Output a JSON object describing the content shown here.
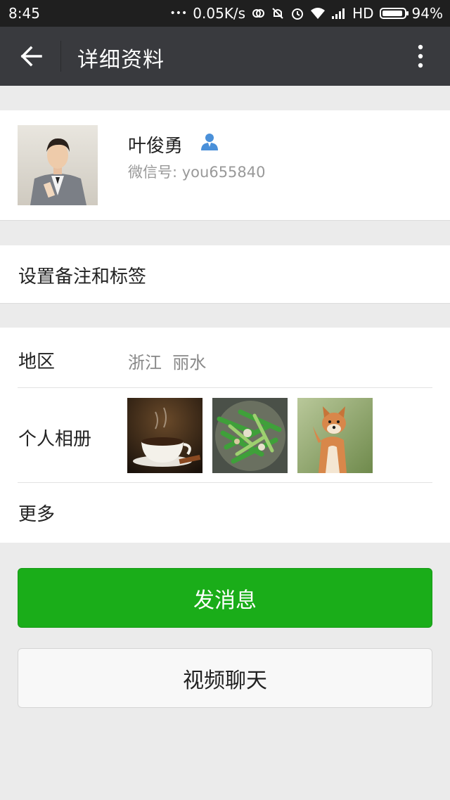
{
  "status_bar": {
    "time": "8:45",
    "dots": "•••",
    "network_speed": "0.05K/s",
    "network_type": "HD",
    "battery_percent": "94%",
    "battery_level": 0.94,
    "icons": [
      "sync-icon",
      "mute-icon",
      "alarm-icon",
      "wifi-icon",
      "signal-icon",
      "battery-icon"
    ]
  },
  "title_bar": {
    "title": "详细资料",
    "back_icon": "arrow-left-icon",
    "more_icon": "more-vertical-icon"
  },
  "profile": {
    "name": "叶俊勇",
    "wechat_id": "微信号: you655840",
    "contact_icon": "contact-person-icon"
  },
  "remark": {
    "label": "设置备注和标签"
  },
  "info": {
    "region_label": "地区",
    "region_value": "浙江  丽水",
    "album_label": "个人相册",
    "album_photos": [
      "coffee-photo",
      "vegetables-photo",
      "shiba-dog-photo"
    ],
    "more_label": "更多"
  },
  "actions": {
    "send_message": "发消息",
    "video_chat": "视频聊天"
  },
  "colors": {
    "status_bar_bg": "#1f1f1f",
    "title_bar_bg": "#393a3e",
    "page_bg": "#ebebeb",
    "primary_green": "#1aad19",
    "contact_icon_blue": "#4a90d9"
  }
}
